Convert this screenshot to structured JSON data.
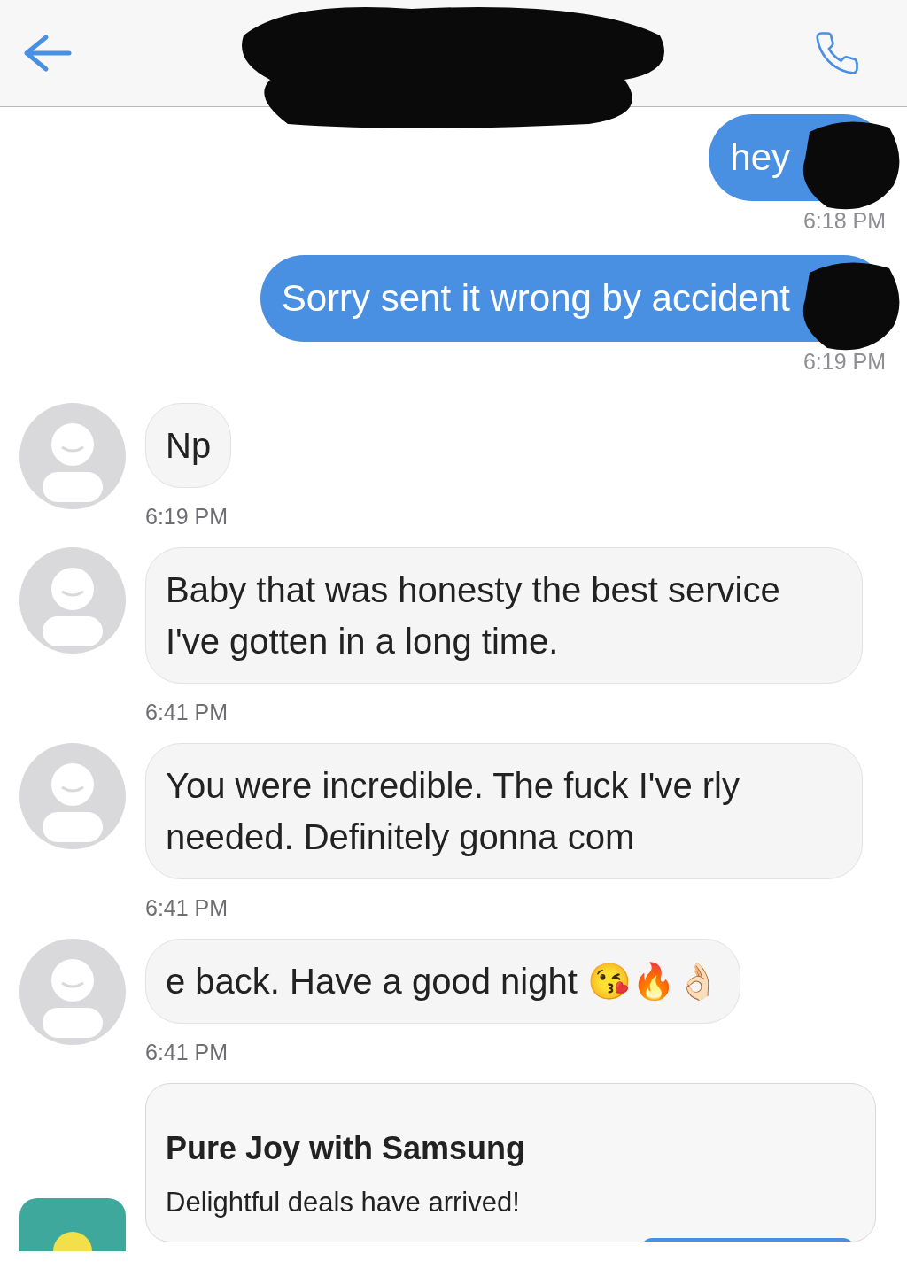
{
  "messages": [
    {
      "kind": "outgoing",
      "text": "hey",
      "time": "6:18 PM",
      "redacted": true
    },
    {
      "kind": "outgoing",
      "text": "Sorry sent it wrong by accident",
      "time": "6:19 PM",
      "redacted": true
    },
    {
      "kind": "incoming",
      "text": "Np",
      "time": "6:19 PM"
    },
    {
      "kind": "incoming",
      "text": "Baby that was honesty the best service I've gotten in a long time.",
      "time": "6:41 PM"
    },
    {
      "kind": "incoming",
      "text": "You were incredible. The fuck I've rly needed. Definitely gonna com",
      "time": "6:41 PM"
    },
    {
      "kind": "incoming",
      "text": "e back. Have a good night 😘🔥👌🏻",
      "time": "6:41 PM"
    },
    {
      "kind": "ad",
      "title": "Pure Joy with Samsung",
      "text": "Delightful deals have arrived!"
    }
  ]
}
